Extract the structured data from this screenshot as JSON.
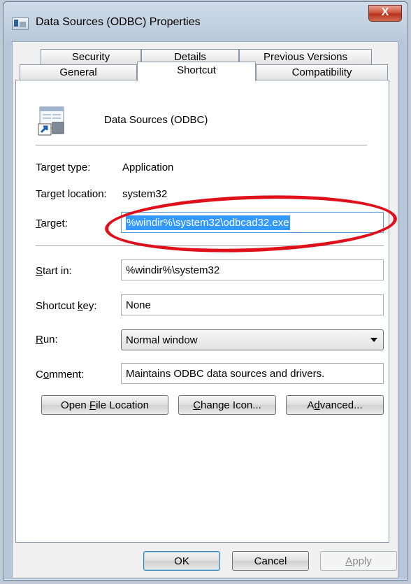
{
  "window": {
    "title": "Data Sources (ODBC) Properties",
    "close_label": "X"
  },
  "tabs": {
    "row1": [
      "Security",
      "Details",
      "Previous Versions"
    ],
    "row2": [
      "General",
      "Shortcut",
      "Compatibility"
    ],
    "selected": "Shortcut"
  },
  "shortcut": {
    "name": "Data Sources (ODBC)",
    "target_type_label": "Target type:",
    "target_type_value": "Application",
    "target_location_label": "Target location:",
    "target_location_value": "system32",
    "target_label_first": "T",
    "target_label_rest": "arget:",
    "target_value": "%windir%\\system32\\odbcad32.exe",
    "start_in_label_first": "S",
    "start_in_label_rest": "tart in:",
    "start_in_value": "%windir%\\system32",
    "shortcut_key_label_a": "Shortcut ",
    "shortcut_key_label_u": "k",
    "shortcut_key_label_b": "ey:",
    "shortcut_key_value": "None",
    "run_label_first": "R",
    "run_label_rest": "un:",
    "run_value": "Normal window",
    "comment_label_a": "C",
    "comment_label_u": "o",
    "comment_label_b": "mment:",
    "comment_value": "Maintains ODBC data sources and drivers."
  },
  "buttons": {
    "open_file_location_a": "Open ",
    "open_file_location_u": "F",
    "open_file_location_b": "ile Location",
    "change_icon_u": "C",
    "change_icon_b": "hange Icon...",
    "advanced_a": "A",
    "advanced_u": "d",
    "advanced_b": "vanced...",
    "ok": "OK",
    "cancel": "Cancel",
    "apply_u": "A",
    "apply_b": "pply"
  },
  "annotation": {
    "color": "#e0101a"
  }
}
